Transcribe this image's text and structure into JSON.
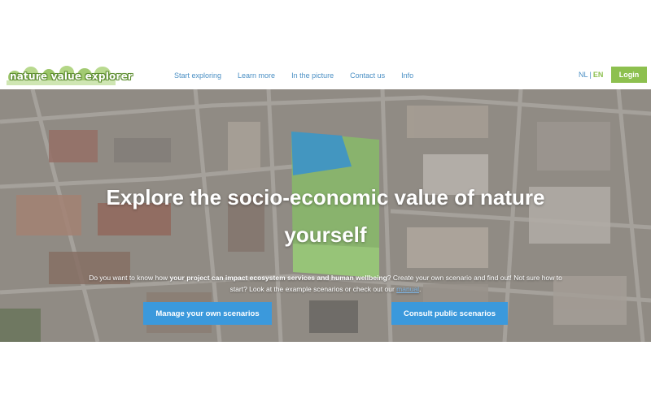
{
  "header": {
    "logo_text": "nature value explorer",
    "nav": [
      "Start exploring",
      "Learn more",
      "In the picture",
      "Contact us",
      "Info"
    ],
    "lang_nl": "NL",
    "lang_sep": "|",
    "lang_en": "EN",
    "login_label": "Login"
  },
  "hero": {
    "title_line1": "Explore the socio-economic value of nature",
    "title_line2": "yourself",
    "intro_part1": "Do you want to know how ",
    "intro_bold": "your project can impact ecosystem services and human wellbeing",
    "intro_part2": "? Create your own scenario and find out! Not sure how to start? Look at the example scenarios or check out our ",
    "intro_link": "manual",
    "intro_end": ".",
    "btn_manage": "Manage your own scenarios",
    "btn_consult": "Consult public scenarios"
  },
  "colors": {
    "accent_green": "#8dc04f",
    "link_blue": "#4a8fc4",
    "button_blue": "#3b99dc"
  }
}
